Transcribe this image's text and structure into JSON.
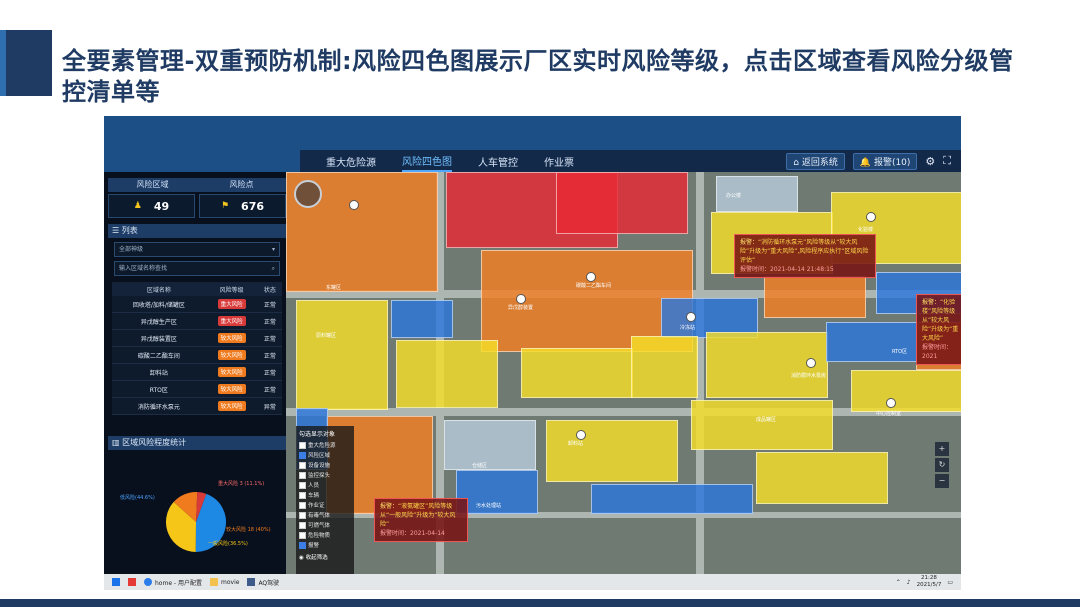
{
  "slide": {
    "title": "全要素管理-双重预防机制:风险四色图展示厂区实时风险等级，点击区域查看风险分级管控清单等"
  },
  "app": {
    "nav_items": [
      "重大危险源",
      "风险四色图",
      "人车管控",
      "作业票"
    ],
    "active_nav": "风险四色图",
    "return_button": "返回系统",
    "alarm_button": "报警(10)",
    "settings_icon": "gear-icon",
    "fullscreen_icon": "fullscreen-icon"
  },
  "stats": {
    "risk_area_label": "风险区域",
    "risk_point_label": "风险点",
    "risk_area_value": "49",
    "risk_point_value": "676"
  },
  "list_panel": {
    "title": "列表",
    "select_value": "全部神级",
    "search_placeholder": "输入区域名称查找",
    "columns": [
      "区域名称",
      "风险等级",
      "状态"
    ],
    "rows": [
      {
        "name": "回收塔/加料/储罐区",
        "level": "重大风险",
        "level_type": "r",
        "status": "正常"
      },
      {
        "name": "异戊醇生产区",
        "level": "重大风险",
        "level_type": "r",
        "status": "正常"
      },
      {
        "name": "异戊醇装置区",
        "level": "较大风险",
        "level_type": "o",
        "status": "正常"
      },
      {
        "name": "碳酸二乙酯车间",
        "level": "较大风险",
        "level_type": "o",
        "status": "正常"
      },
      {
        "name": "卸料站",
        "level": "较大风险",
        "level_type": "o",
        "status": "正常"
      },
      {
        "name": "RTO区",
        "level": "较大风险",
        "level_type": "o",
        "status": "正常"
      },
      {
        "name": "消防循环水泵元",
        "level": "较大风险",
        "level_type": "o",
        "status": "异常"
      }
    ]
  },
  "pie_panel": {
    "title": "区域风险程度统计",
    "slices": [
      {
        "label": "低风险",
        "value": 44.6,
        "color": "#1e88e5"
      },
      {
        "label": "一般风险",
        "value": 36.5,
        "color": "#f5c518"
      },
      {
        "label": "较大风险",
        "value": 14.0,
        "color": "#f07b1f"
      },
      {
        "label": "重大风险",
        "value": 4.9,
        "color": "#d83a3a"
      }
    ],
    "labels": [
      "低风险(44.6%)",
      "一般风险(36.5%)",
      "较大风险 18 (40%)",
      "重大风险 3 (11.1%)"
    ]
  },
  "alarms": [
    {
      "title": "报警：",
      "text": "“消防循环水泵元”风险等级从“较大风险”升级为“重大风险”,风险程序应执行“区域风险评估”",
      "time": "报警时间：2021-04-14 21:48:15"
    },
    {
      "title": "报警：",
      "text": "“化验楼”风险等级从“较大风险”升级为“重大风险”",
      "time": "报警时间：2021"
    },
    {
      "title": "报警：",
      "text": "“液氨罐区”风险等级从“一般风险”升级为“较大风险”",
      "time": "报警时间：2021-04-14"
    }
  ],
  "map_labels": [
    "东罐区",
    "异戊醇装置",
    "碳酸二乙酯车间",
    "消防循环水泵房",
    "化验楼",
    "冷冻站",
    "RTO区",
    "中心控制室",
    "卸料站",
    "仓储区",
    "办公楼",
    "污水处理站",
    "原料罐区",
    "成品罐区"
  ],
  "layer_panel": {
    "title": "勾选显示对象",
    "items": [
      {
        "label": "重大危险源",
        "checked": false
      },
      {
        "label": "风险区域",
        "checked": true
      },
      {
        "label": "设备设施",
        "checked": false
      },
      {
        "label": "监控探头",
        "checked": false
      },
      {
        "label": "人员",
        "checked": false
      },
      {
        "label": "车辆",
        "checked": false
      },
      {
        "label": "作业证",
        "checked": false
      },
      {
        "label": "有毒气体",
        "checked": false
      },
      {
        "label": "可燃气体",
        "checked": false
      },
      {
        "label": "危险物质",
        "checked": false
      },
      {
        "label": "报警",
        "checked": true
      }
    ],
    "footer": "收起筛选"
  },
  "taskbar": {
    "items": [
      "home - 用户配置",
      "movie",
      "AQ驾驶"
    ],
    "clock_time": "21:28",
    "clock_date": "2021/5/7"
  }
}
